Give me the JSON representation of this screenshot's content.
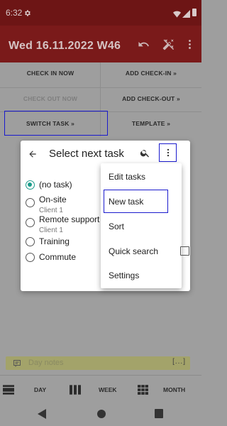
{
  "status_bar": {
    "time": "6:32"
  },
  "app_bar": {
    "title": "Wed 16.11.2022 W46"
  },
  "actions": {
    "check_in_now": "CHECK IN NOW",
    "add_check_in": "ADD CHECK-IN »",
    "check_out_now": "CHECK OUT NOW",
    "add_check_out": "ADD CHECK-OUT »",
    "switch_task": "SWITCH TASK »",
    "template": "TEMPLATE »"
  },
  "dialog": {
    "title": "Select next task",
    "tasks": [
      {
        "label": "(no task)",
        "sub": "",
        "checked": true
      },
      {
        "label": "On-site",
        "sub": "Client 1",
        "checked": false
      },
      {
        "label": "Remote support",
        "sub": "Client 1",
        "checked": false
      },
      {
        "label": "Training",
        "sub": "",
        "checked": false
      },
      {
        "label": "Commute",
        "sub": "",
        "checked": false
      }
    ]
  },
  "menu": {
    "items": [
      {
        "label": "Edit tasks"
      },
      {
        "label": "New task"
      },
      {
        "label": "Sort"
      },
      {
        "label": "Quick search"
      },
      {
        "label": "Settings"
      }
    ]
  },
  "notes": {
    "placeholder": "Day notes",
    "expand": "[...]"
  },
  "tabs": {
    "day": "DAY",
    "week": "WEEK",
    "month": "MONTH"
  },
  "colors": {
    "status_bar": "#6d1515",
    "app_bar": "#7a1a1a",
    "accent": "#1a9b8a",
    "highlight": "#1a1acd"
  }
}
